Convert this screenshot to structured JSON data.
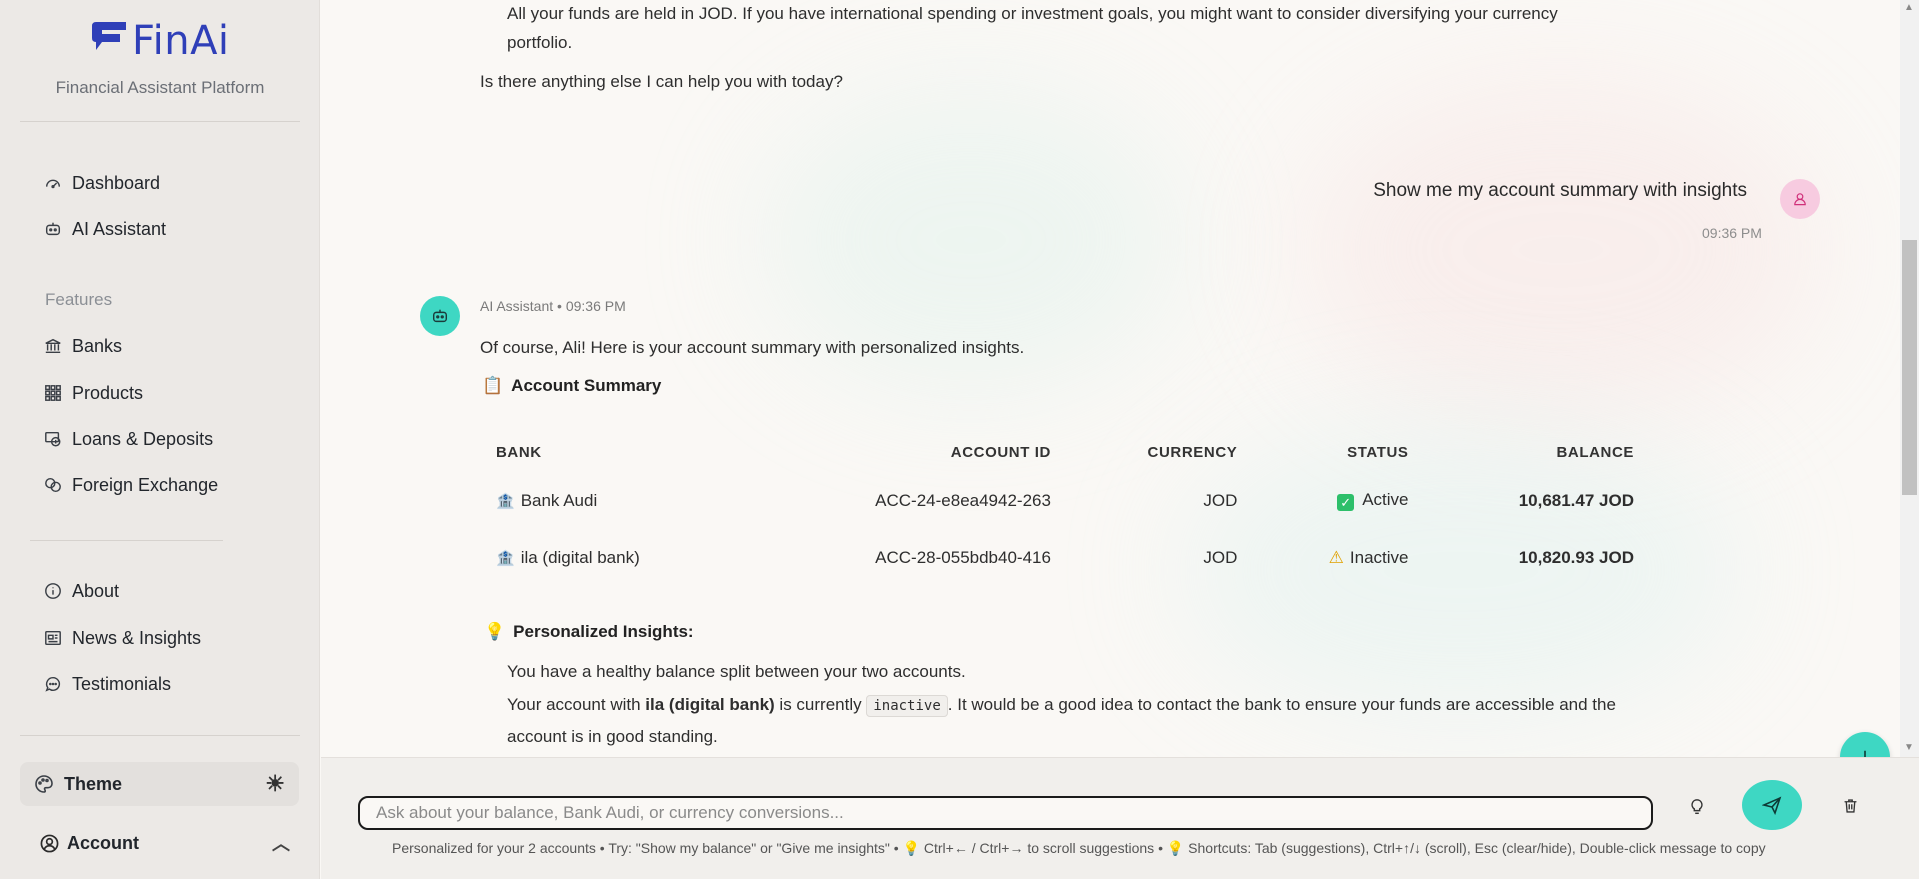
{
  "brand": {
    "name": "FinAi",
    "subtitle": "Financial Assistant Platform",
    "accent": "#2f3fb8"
  },
  "sidebar": {
    "primary": [
      {
        "label": "Dashboard",
        "icon": "gauge-icon"
      },
      {
        "label": "AI Assistant",
        "icon": "robot-icon"
      }
    ],
    "features_label": "Features",
    "features": [
      {
        "label": "Banks",
        "icon": "bank-icon"
      },
      {
        "label": "Products",
        "icon": "grid-icon"
      },
      {
        "label": "Loans & Deposits",
        "icon": "loan-icon"
      },
      {
        "label": "Foreign Exchange",
        "icon": "exchange-icon"
      }
    ],
    "secondary": [
      {
        "label": "About",
        "icon": "info-icon"
      },
      {
        "label": "News & Insights",
        "icon": "news-icon"
      },
      {
        "label": "Testimonials",
        "icon": "chat-icon"
      }
    ],
    "theme_label": "Theme",
    "account_label": "Account"
  },
  "chat": {
    "prev_line_1": "All your funds are held in JOD. If you have international spending or investment goals, you might want to consider diversifying your currency",
    "prev_line_2": "portfolio.",
    "prev_question": "Is there anything else I can help you with today?",
    "user_message": "Show me my account summary with insights",
    "user_time": "09:36 PM",
    "bot_meta": "AI Assistant • 09:36 PM",
    "bot_intro": "Of course, Ali! Here is your account summary with personalized insights.",
    "summary_heading": "Account Summary",
    "table": {
      "headers": [
        "BANK",
        "ACCOUNT ID",
        "CURRENCY",
        "STATUS",
        "BALANCE"
      ],
      "rows": [
        {
          "bank": "Bank Audi",
          "account_id": "ACC-24-e8ea4942-263",
          "currency": "JOD",
          "status": "Active",
          "balance": "10,681.47 JOD"
        },
        {
          "bank": "ila (digital bank)",
          "account_id": "ACC-28-055bdb40-416",
          "currency": "JOD",
          "status": "Inactive",
          "balance": "10,820.93 JOD"
        }
      ]
    },
    "insights_heading": "Personalized Insights:",
    "insight_1": "You have a healthy balance split between your two accounts.",
    "insight_2_pre": "Your account with ",
    "insight_2_bank": "ila (digital bank)",
    "insight_2_mid": " is currently ",
    "insight_2_code": "inactive",
    "insight_2_post": ". It would be a good idea to contact the bank to ensure your funds are accessible and the",
    "insight_2_line2": "account is in good standing."
  },
  "composer": {
    "placeholder": "Ask about your balance, Bank Audi, or currency conversions...",
    "footer_hint": "Personalized for your 2 accounts • Try: \"Show my balance\" or \"Give me insights\" • 💡 Ctrl+← / Ctrl+→ to scroll suggestions • 💡 Shortcuts: Tab (suggestions), Ctrl+↑/↓ (scroll), Esc (clear/hide), Double-click message to copy"
  },
  "colors": {
    "teal": "#3ed7c3",
    "pink": "#f7cbe0",
    "active": "#2dbf6a",
    "warning": "#e0a100"
  }
}
